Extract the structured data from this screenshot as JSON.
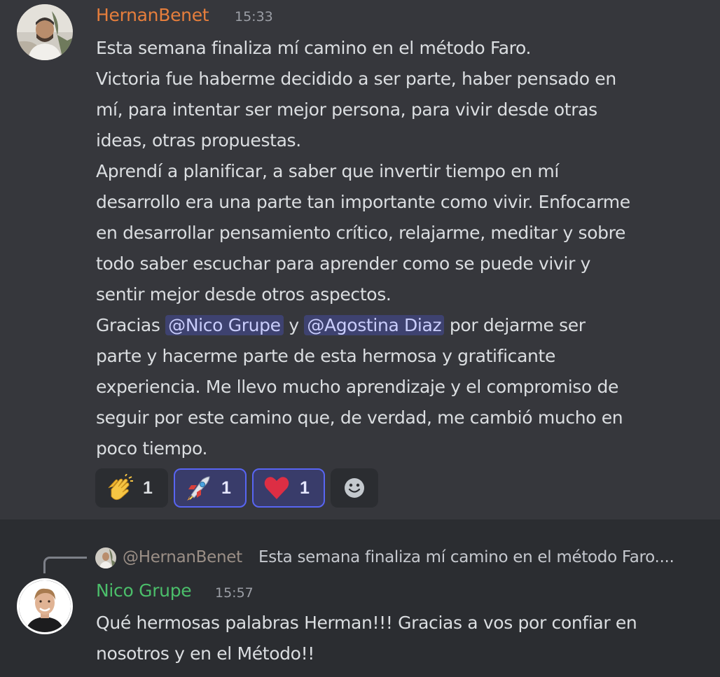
{
  "message1": {
    "author": "HernanBenet",
    "author_color": "#e67e3c",
    "time": "15:33",
    "lines": [
      "Esta semana finaliza mí camino en el método Faro.",
      "Victoria fue haberme decidido a ser parte, haber pensado en",
      "mí, para intentar ser mejor persona, para vivir desde otras",
      "ideas, otras propuestas.",
      "Aprendí a planificar, a saber que invertir tiempo en mí",
      "desarrollo era una parte tan importante como vivir. Enfocarme",
      "en desarrollar pensamiento crítico, relajarme, meditar y sobre",
      "todo saber escuchar para aprender como se puede vivir y",
      "sentir mejor desde otros aspectos."
    ],
    "thanks_prefix": "Gracias",
    "mention1": "@Nico Grupe",
    "thanks_mid": "y",
    "mention2": "@Agostina Diaz",
    "thanks_suffix": "por dejarme ser",
    "lines_after": [
      "parte y hacerme parte de esta hermosa y gratificante",
      "experiencia. Me llevo mucho aprendizaje y el compromiso de",
      "seguir por este camino que, de verdad, me cambió mucho en",
      "poco tiempo."
    ],
    "reactions": [
      {
        "icon": "clapping-hands-icon",
        "count": "1",
        "me": false
      },
      {
        "icon": "rocket-icon",
        "count": "1",
        "me": true
      },
      {
        "icon": "red-heart-icon",
        "count": "1",
        "me": true
      }
    ],
    "add_reaction_icon": "smiley-add-reaction-icon"
  },
  "message2": {
    "reply_to_author": "@HernanBenet",
    "reply_preview": "Esta semana finaliza mí camino en el método Faro....",
    "author": "Nico Grupe",
    "author_color": "#4bbe6a",
    "time": "15:57",
    "lines": [
      "Qué hermosas palabras Herman!!! Gracias a vos por confiar en",
      "nosotros y en el Método!!"
    ]
  }
}
